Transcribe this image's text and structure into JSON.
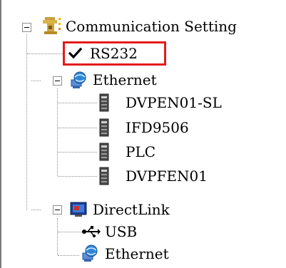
{
  "tree": {
    "root": {
      "label": "Communication Setting",
      "icon": "settings-gear-icon",
      "expanded": true
    },
    "items": [
      {
        "label": "RS232",
        "icon": "checkmark-icon",
        "selected": true
      },
      {
        "label": "Ethernet",
        "icon": "network-computer-icon",
        "expanded": true,
        "children": [
          {
            "label": "DVPEN01-SL",
            "icon": "device-module-icon"
          },
          {
            "label": "IFD9506",
            "icon": "device-module-icon"
          },
          {
            "label": "PLC",
            "icon": "device-module-icon"
          },
          {
            "label": "DVPFEN01",
            "icon": "device-module-icon"
          }
        ]
      },
      {
        "label": "DirectLink",
        "icon": "directlink-monitor-icon",
        "expanded": true,
        "children": [
          {
            "label": "USB",
            "icon": "usb-icon"
          },
          {
            "label": "Ethernet",
            "icon": "network-computer-icon"
          }
        ]
      }
    ]
  },
  "colors": {
    "highlight": "#e41b1b",
    "tree_lines": "#8e8e8e"
  }
}
